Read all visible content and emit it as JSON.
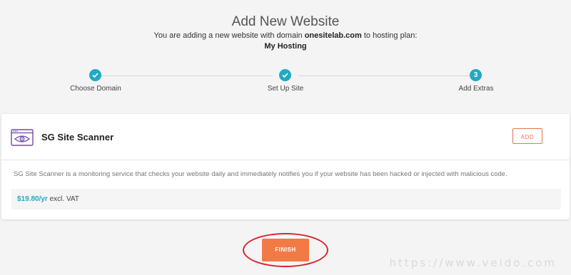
{
  "header": {
    "title": "Add New Website",
    "subtitle_prefix": "You are adding a new website with domain",
    "domain": "onesitelab.com",
    "subtitle_suffix": "to hosting plan:",
    "plan": "My Hosting"
  },
  "stepper": {
    "steps": [
      {
        "label": "Choose Domain",
        "state": "done"
      },
      {
        "label": "Set Up Site",
        "state": "done"
      },
      {
        "label": "Add Extras",
        "state": "current",
        "number": "3"
      }
    ],
    "accent_color": "#22a9c4"
  },
  "extra": {
    "icon": "site-scanner-icon",
    "title": "SG Site Scanner",
    "add_label": "ADD",
    "description": "SG Site Scanner is a monitoring service that checks your website daily and immediately notifies you if your website has been hacked or injected with malicious code.",
    "price": "$19.80/yr",
    "price_suffix": "excl. VAT"
  },
  "footer": {
    "finish_label": "FINISH",
    "watermark": "https://www.veido.com"
  },
  "colors": {
    "accent": "#22a9c4",
    "cta": "#f27a45",
    "annotation_ring": "#d9242e",
    "icon_purple": "#6f4aa8"
  }
}
